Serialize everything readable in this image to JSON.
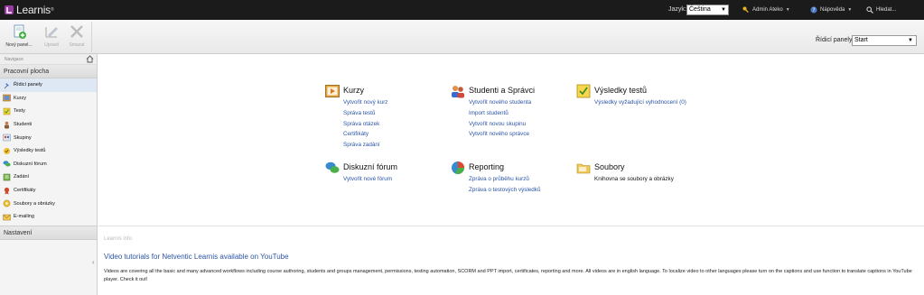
{
  "app": {
    "logo_text": "Learnis",
    "logo_sup": "®"
  },
  "topbar": {
    "language_label": "Jazyk:",
    "language_value": "Čeština",
    "user": "Admin Ateko",
    "help": "Nápověda",
    "search": "Hledat..."
  },
  "toolbar": {
    "buttons": [
      {
        "label": "Nový panel..."
      },
      {
        "label": "Upravit"
      },
      {
        "label": "Smazat"
      }
    ],
    "dashboard_label": "Řídicí panely",
    "dashboard_value": "Start"
  },
  "sidebar": {
    "nav_header": "Navigace",
    "section": "Pracovní plocha",
    "items": [
      {
        "label": "Řídicí panely",
        "icon": "pin-icon"
      },
      {
        "label": "Kurzy",
        "icon": "course-icon"
      },
      {
        "label": "Testy",
        "icon": "test-icon"
      },
      {
        "label": "Studenti",
        "icon": "students-icon"
      },
      {
        "label": "Skupiny",
        "icon": "groups-icon"
      },
      {
        "label": "Výsledky testů",
        "icon": "results-icon"
      },
      {
        "label": "Diskuzní fórum",
        "icon": "forum-icon"
      },
      {
        "label": "Zadání",
        "icon": "assignment-icon"
      },
      {
        "label": "Certifikáty",
        "icon": "certificate-icon"
      },
      {
        "label": "Soubory a obrázky",
        "icon": "files-icon"
      },
      {
        "label": "E-mailing",
        "icon": "email-icon"
      }
    ],
    "settings": "Nastavení"
  },
  "dashboard": {
    "kurzy": {
      "title": "Kurzy",
      "links": [
        "Vytvořit nový kurz",
        "Správa testů",
        "Správa otázek",
        "Certifikáty",
        "Správa zadání"
      ]
    },
    "studenti": {
      "title": "Studenti a Správci",
      "links": [
        "Vytvořit nového studenta",
        "Import studentů",
        "Vytvořit novou skupinu",
        "Vytvořit nového správce"
      ]
    },
    "vysledky": {
      "title": "Výsledky testů",
      "links": [
        "Výsledky vyžadující vyhodnocení (0)"
      ]
    },
    "forum": {
      "title": "Diskuzní fórum",
      "links": [
        "Vytvořit nové fórum"
      ]
    },
    "reporting": {
      "title": "Reporting",
      "links": [
        "Zpráva o průběhu kurzů",
        "Zpráva o testových výsledků"
      ]
    },
    "soubory": {
      "title": "Soubory",
      "text": "Knihovna se soubory a obrázky"
    }
  },
  "info": {
    "label": "Learnis info",
    "title": "Video tutorials for Netventic Learnis available on YouTube",
    "body": "Videos are covering all the basic and many advanced workflows including course authoring, students and groups management, permissions, testing automation, SCORM and PPT import, certificates, reporting and more. All videos are in english language. To localize video to other languages please turn on the captions and use function to translate captions in YouTube player. Check it out!"
  },
  "colors": {
    "topbar": "#1b1b1b",
    "link": "#2b55a6",
    "active_nav": "#dde8f4"
  }
}
